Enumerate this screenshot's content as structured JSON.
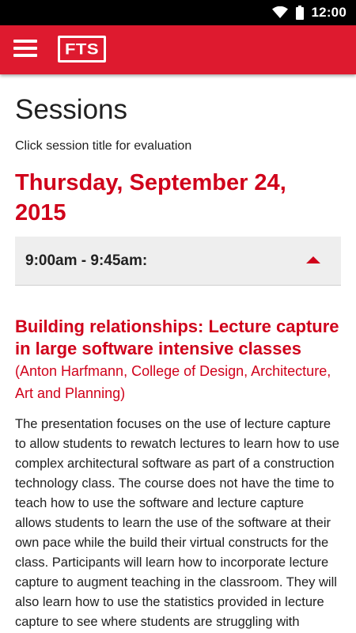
{
  "status_bar": {
    "time": "12:00"
  },
  "app_bar": {
    "logo_text": "FTS"
  },
  "page": {
    "title": "Sessions",
    "subtitle": "Click session title for evaluation",
    "day": "Thursday, September 24, 2015",
    "time_slot": "9:00am - 9:45am:"
  },
  "session": {
    "title": "Building relationships: Lecture capture in large software intensive classes",
    "presenter": "(Anton Harfmann, College of Design, Architecture, Art and Planning)",
    "description": "The presentation focuses on the use of lecture capture to allow students to rewatch lectures to learn how to use complex architectural software as part of a construction technology class. The course does not have the time to teach how to use the software and lecture capture allows students to learn the use of the software at their own pace while the build their virtual constructs for the class. Participants will learn how to incorporate lecture capture to augment teaching in the classroom. They will also learn how to use the statistics provided in lecture capture to see where students are struggling with content."
  },
  "colors": {
    "accent": "#de1a2f",
    "text_accent": "#d0021b"
  },
  "icons": [
    "wifi-icon",
    "battery-icon",
    "menu-icon",
    "expand-less-icon"
  ]
}
